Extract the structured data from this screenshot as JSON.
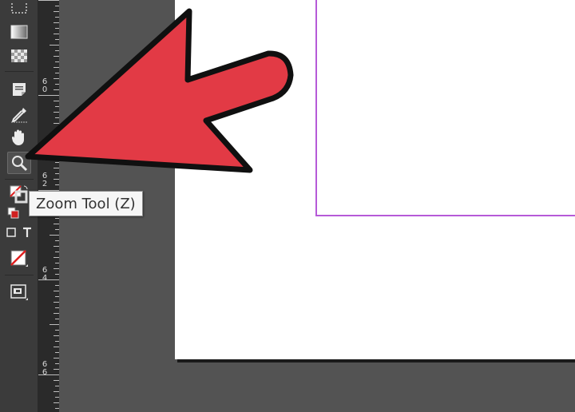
{
  "tooltip": {
    "text": "Zoom Tool (Z)"
  },
  "ruler": {
    "labels": [
      {
        "digits": [
          "6",
          "0"
        ]
      },
      {
        "digits": [
          "6",
          "2"
        ]
      },
      {
        "digits": [
          "6",
          "4"
        ]
      },
      {
        "digits": [
          "6",
          "6"
        ]
      }
    ]
  },
  "tools": [
    "marquee-tool-icon",
    "gradient-swatch-tool-icon",
    "gradient-feather-tool-icon",
    "note-tool-icon",
    "eyedropper-tool-icon",
    "hand-tool-icon",
    "zoom-tool-icon",
    "fill-stroke-icon",
    "default-colors-icon",
    "formatting-container-icon",
    "formatting-text-icon",
    "apply-none-icon",
    "screen-mode-icon"
  ],
  "colors": {
    "arrow_fill": "#e23a45",
    "guide": "#b65ad8",
    "pasteboard": "#535353",
    "toolbar": "#3b3b3b"
  }
}
